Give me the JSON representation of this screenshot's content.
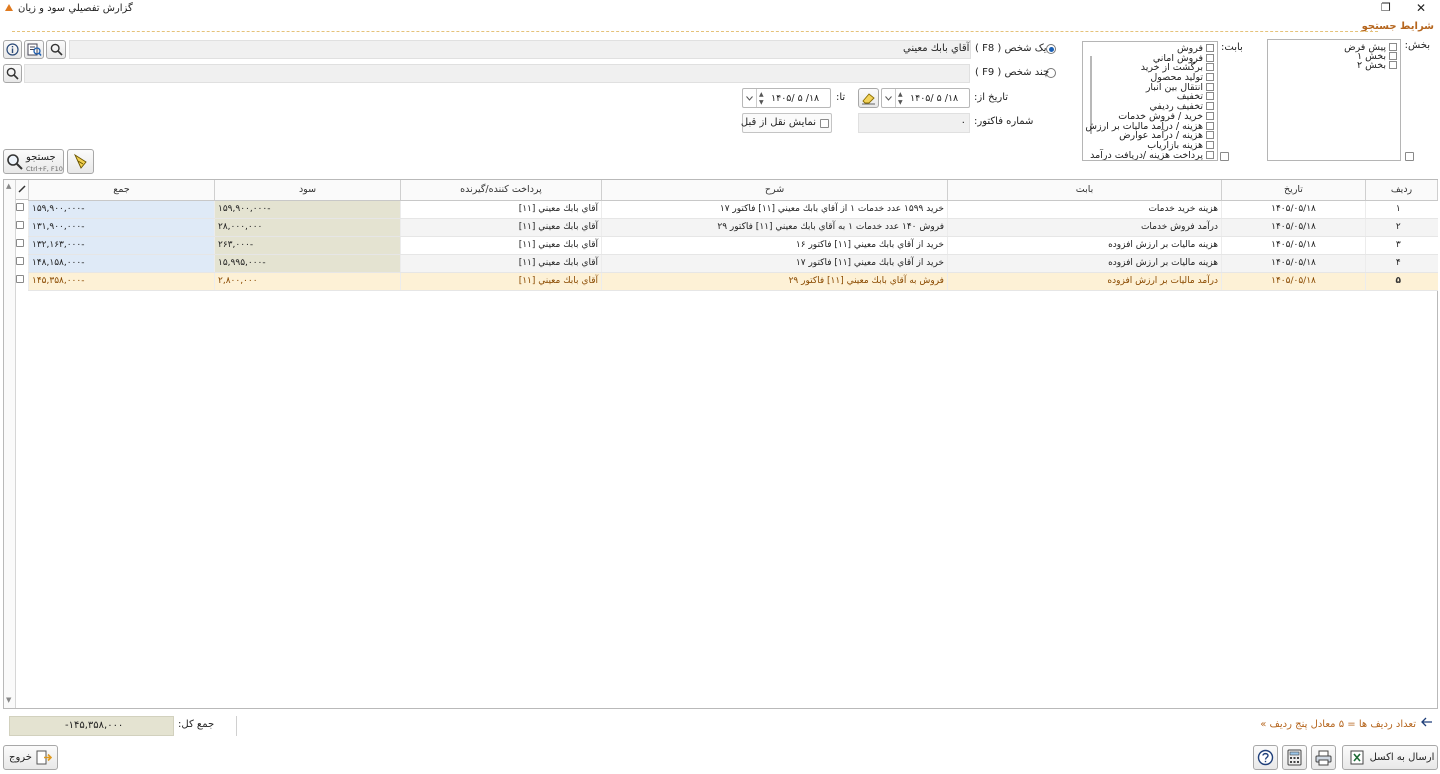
{
  "window": {
    "title": "گزارش تفصيلي سود و زيان",
    "restore_glyph": "❐",
    "close_glyph": "✕"
  },
  "section": {
    "title": "شرايط جستجو"
  },
  "filters": {
    "bakhsh_label": "بخش:",
    "bakhsh_items": [
      "پيش فرض",
      "بخش ۱",
      "بخش ۲"
    ],
    "babat_label": "بابت:",
    "babat_items": [
      "فروش",
      "فروش اماني",
      "برگشت از خريد",
      "توليد محصول",
      "انتقال بين انبار",
      "تخفيف",
      "تخفيف رديفي",
      "خريد / فروش خدمات",
      "هزينه / درآمد ماليات بر ارزش",
      "هزينه / درآمد عوارض",
      "هزينه بازارياب",
      "پرداخت هزينه /دريافت درآمد"
    ],
    "one_person_label": "يک شخص ( F8 )",
    "one_person_value": "آقاي بابك معيني",
    "multi_person_label": "چند شخص ( F9 )",
    "date_from_label": "تاريخ از:",
    "date_from": "۱۴۰۵/ ۵ /۱۸",
    "date_to_label": "تا:",
    "date_to": "۱۴۰۵/ ۵ /۱۸",
    "invoice_label": "شماره فاکتور:",
    "invoice_value": "۰",
    "show_prev_label": "نمايش نقل از قبل"
  },
  "search_button": {
    "label": "جستجو",
    "shortcut": "Ctrl+F, F10"
  },
  "table": {
    "columns": {
      "radif": "رديف",
      "date": "تاريخ",
      "babat": "بابت",
      "sharh": "شرح",
      "payer": "پرداخت کننده/گيرنده",
      "sood": "سود",
      "jam": "جمع"
    },
    "rows": [
      {
        "radif": "۱",
        "date": "۱۴۰۵/۰۵/۱۸",
        "babat": "هزينه خريد خدمات",
        "sharh": "خريد ۱۵۹۹ عدد خدمات ۱  از  آقاي بابك معيني [۱۱] فاکتور ۱۷",
        "payer": "آقاي بابك معيني [۱۱]",
        "sood": "-۱۵۹,۹۰۰,۰۰۰",
        "jam": "-۱۵۹,۹۰۰,۰۰۰"
      },
      {
        "radif": "۲",
        "date": "۱۴۰۵/۰۵/۱۸",
        "babat": "درآمد فروش خدمات",
        "sharh": "فروش ۱۴۰ عدد خدمات ۱  به  آقاي بابك معيني [۱۱] فاکتور ۲۹",
        "payer": "آقاي بابك معيني [۱۱]",
        "sood": "۲۸,۰۰۰,۰۰۰",
        "jam": "-۱۳۱,۹۰۰,۰۰۰"
      },
      {
        "radif": "۳",
        "date": "۱۴۰۵/۰۵/۱۸",
        "babat": "هزينه ماليات بر ارزش افزوده",
        "sharh": "خريد  از  آقاي بابك معيني [۱۱] فاکتور ۱۶",
        "payer": "آقاي بابك معيني [۱۱]",
        "sood": "-۲۶۳,۰۰۰",
        "jam": "-۱۳۲,۱۶۳,۰۰۰"
      },
      {
        "radif": "۴",
        "date": "۱۴۰۵/۰۵/۱۸",
        "babat": "هزينه ماليات بر ارزش افزوده",
        "sharh": "خريد  از  آقاي بابك معيني [۱۱] فاکتور ۱۷",
        "payer": "آقاي بابك معيني [۱۱]",
        "sood": "-۱۵,۹۹۵,۰۰۰",
        "jam": "-۱۴۸,۱۵۸,۰۰۰"
      },
      {
        "radif": "۵",
        "date": "۱۴۰۵/۰۵/۱۸",
        "babat": "درآمد ماليات بر ارزش افزوده",
        "sharh": "فروش  به  آقاي بابك معيني [۱۱] فاکتور ۲۹",
        "payer": "آقاي بابك معيني [۱۱]",
        "sood": "۲,۸۰۰,۰۰۰",
        "jam": "-۱۴۵,۳۵۸,۰۰۰"
      }
    ]
  },
  "footer": {
    "row_count_text": "تعداد رديف ها = ۵ معادل پنج  رديف »",
    "total_label": "جمع کل:",
    "total_value": "-۱۴۵,۳۵۸,۰۰۰",
    "excel_label": "ارسال به اکسل",
    "exit_label": "خروج"
  },
  "colors": {
    "accent": "#b5651d",
    "sood_bg": "#e4e3d1",
    "jam_bg": "#dfeaf7",
    "selected_row": "#fdf1d6"
  }
}
